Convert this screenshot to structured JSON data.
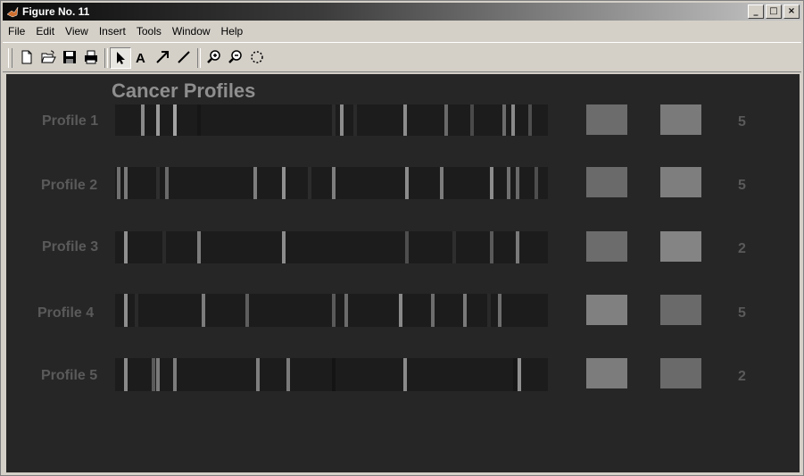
{
  "window": {
    "title": "Figure No. 11"
  },
  "window_buttons": [
    "_",
    "□",
    "×"
  ],
  "menu": [
    "File",
    "Edit",
    "View",
    "Insert",
    "Tools",
    "Window",
    "Help"
  ],
  "toolbar": {
    "tools": [
      "new-file-icon",
      "open-folder-icon",
      "save-icon",
      "print-icon",
      "pointer-arrow-icon",
      "text-insert-icon",
      "arrow-insert-icon",
      "line-insert-icon",
      "zoom-in-icon",
      "zoom-out-icon",
      "rotate-icon"
    ],
    "selected_tool": "pointer-arrow-icon"
  },
  "figure": {
    "title": "Cancer Profiles",
    "background": "#262626",
    "profiles": [
      {
        "label": "Profile 1",
        "count": "5",
        "left_square": "#6c6c6c",
        "right_square": "#7a7a7a",
        "stripes": [
          [
            0.06,
            "#8a8a8a"
          ],
          [
            0.095,
            "#9a9a9a"
          ],
          [
            0.135,
            "#a4a4a4"
          ],
          [
            0.19,
            "#161616"
          ],
          [
            0.5,
            "#2c2c2c"
          ],
          [
            0.52,
            "#8c8c8c"
          ],
          [
            0.55,
            "#2a2a2a"
          ],
          [
            0.665,
            "#8c8c8c"
          ],
          [
            0.76,
            "#6a6a6a"
          ],
          [
            0.82,
            "#4a4a4a"
          ],
          [
            0.895,
            "#6c6c6c"
          ],
          [
            0.915,
            "#8a8a8a"
          ],
          [
            0.955,
            "#4e4e4e"
          ]
        ]
      },
      {
        "label": "Profile 2",
        "count": "5",
        "left_square": "#6a6a6a",
        "right_square": "#7e7e7e",
        "stripes": [
          [
            0.005,
            "#707070"
          ],
          [
            0.02,
            "#7a7a7a"
          ],
          [
            0.095,
            "#2e2e2e"
          ],
          [
            0.115,
            "#6a6a6a"
          ],
          [
            0.32,
            "#7e7e7e"
          ],
          [
            0.385,
            "#909090"
          ],
          [
            0.445,
            "#2c2c2c"
          ],
          [
            0.5,
            "#7e7e7e"
          ],
          [
            0.67,
            "#8c8c8c"
          ],
          [
            0.75,
            "#7c7c7c"
          ],
          [
            0.865,
            "#8c8c8c"
          ],
          [
            0.905,
            "#707070"
          ],
          [
            0.925,
            "#6a6a6a"
          ],
          [
            0.97,
            "#4e4e4e"
          ]
        ]
      },
      {
        "label": "Profile 3",
        "count": "2",
        "left_square": "#6c6c6c",
        "right_square": "#848484",
        "stripes": [
          [
            0.02,
            "#909090"
          ],
          [
            0.11,
            "#2a2a2a"
          ],
          [
            0.19,
            "#7c7c7c"
          ],
          [
            0.385,
            "#8c8c8c"
          ],
          [
            0.67,
            "#4e4e4e"
          ],
          [
            0.78,
            "#2e2e2e"
          ],
          [
            0.865,
            "#5a5a5a"
          ],
          [
            0.925,
            "#7a7a7a"
          ]
        ]
      },
      {
        "label": "Profile 4",
        "count": "5",
        "left_square": "#808080",
        "right_square": "#6a6a6a",
        "stripes": [
          [
            0.02,
            "#8e8e8e"
          ],
          [
            0.045,
            "#2a2a2a"
          ],
          [
            0.2,
            "#7c7c7c"
          ],
          [
            0.3,
            "#5e5e5e"
          ],
          [
            0.5,
            "#5a5a5a"
          ],
          [
            0.53,
            "#6c6c6c"
          ],
          [
            0.655,
            "#8a8a8a"
          ],
          [
            0.73,
            "#6e6e6e"
          ],
          [
            0.805,
            "#7a7a7a"
          ],
          [
            0.86,
            "#2a2a2a"
          ],
          [
            0.885,
            "#6e6e6e"
          ]
        ]
      },
      {
        "label": "Profile 5",
        "count": "2",
        "left_square": "#7c7c7c",
        "right_square": "#6a6a6a",
        "stripes": [
          [
            0.02,
            "#8a8a8a"
          ],
          [
            0.085,
            "#5a5a5a"
          ],
          [
            0.095,
            "#7a7a7a"
          ],
          [
            0.135,
            "#7c7c7c"
          ],
          [
            0.325,
            "#7e7e7e"
          ],
          [
            0.395,
            "#7a7a7a"
          ],
          [
            0.5,
            "#141414"
          ],
          [
            0.665,
            "#8a8a8a"
          ],
          [
            0.92,
            "#161616"
          ],
          [
            0.93,
            "#909090"
          ]
        ]
      }
    ]
  }
}
